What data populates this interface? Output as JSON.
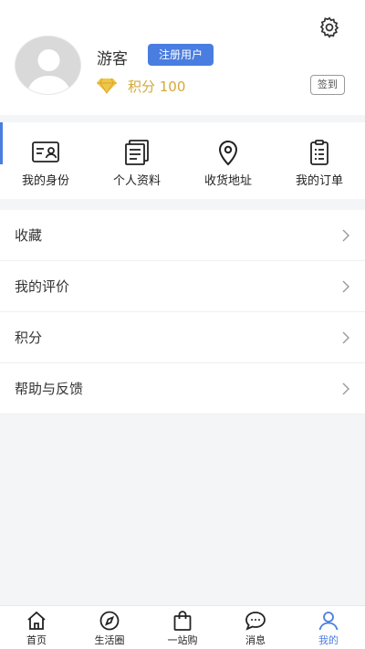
{
  "profile": {
    "username": "游客",
    "badge_label": "注册用户",
    "points_label": "积分 100",
    "signin_label": "签到"
  },
  "shortcuts": [
    {
      "label": "我的身份",
      "icon": "id-card-icon"
    },
    {
      "label": "个人资料",
      "icon": "profile-document-icon"
    },
    {
      "label": "收货地址",
      "icon": "location-pin-icon"
    },
    {
      "label": "我的订单",
      "icon": "clipboard-list-icon"
    }
  ],
  "menu": [
    {
      "label": "收藏"
    },
    {
      "label": "我的评价"
    },
    {
      "label": "积分"
    },
    {
      "label": "帮助与反馈"
    }
  ],
  "tabs": [
    {
      "label": "首页",
      "icon": "home-icon"
    },
    {
      "label": "生活圈",
      "icon": "compass-icon"
    },
    {
      "label": "一站购",
      "icon": "shopping-bag-icon"
    },
    {
      "label": "消息",
      "icon": "chat-bubble-icon"
    },
    {
      "label": "我的",
      "icon": "person-icon"
    }
  ],
  "colors": {
    "accent": "#4a7de0",
    "points_gold": "#d4a93a",
    "page_bg": "#f4f5f7"
  },
  "active_tab": "我的"
}
